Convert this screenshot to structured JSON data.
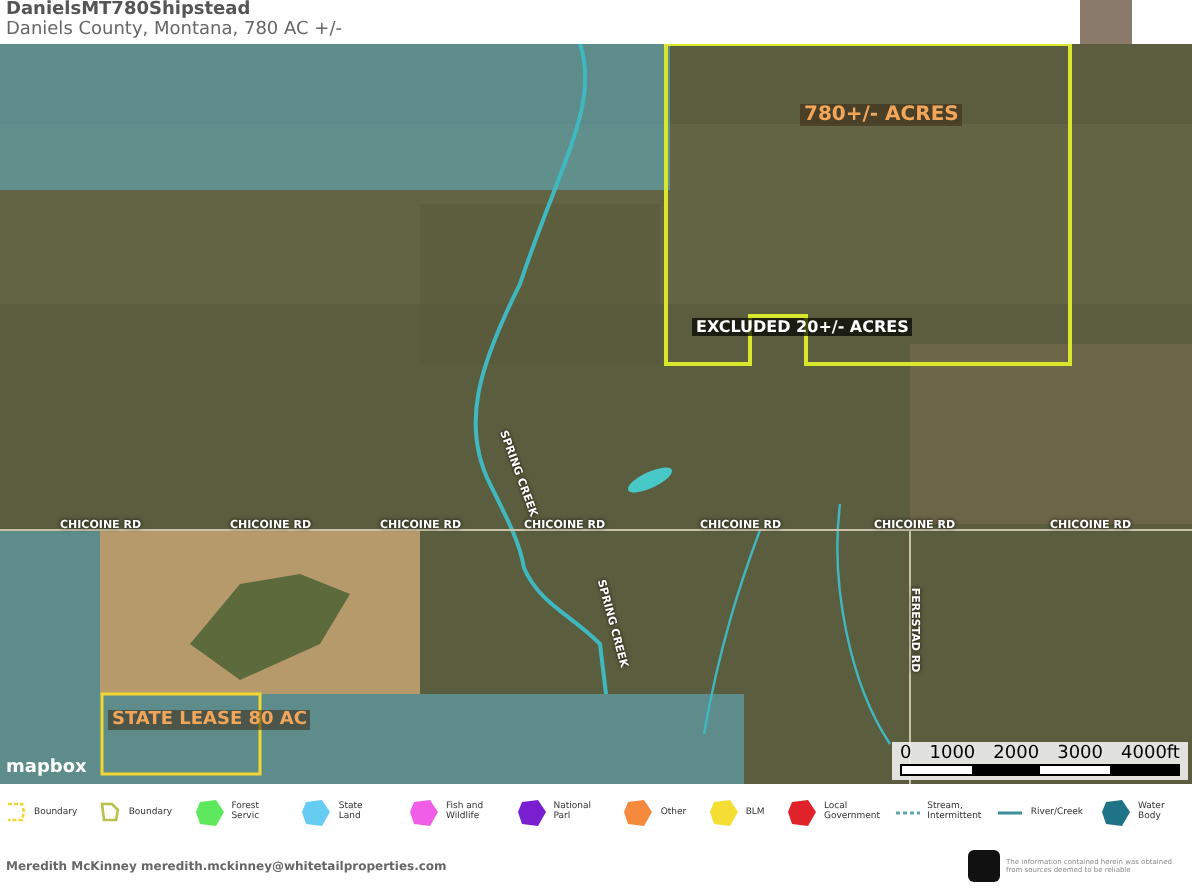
{
  "header": {
    "title": "DanielsMT780Shipstead",
    "subtitle": "Daniels County, Montana, 780 AC +/-"
  },
  "map": {
    "labels": [
      {
        "kind": "acreage",
        "text": "780+/- ACRES"
      },
      {
        "kind": "parcel",
        "text": "EXCLUDED 20+/- ACRES"
      },
      {
        "kind": "acreage",
        "text": "STATE LEASE 80 AC"
      }
    ],
    "roads": [
      "CHICOINE RD",
      "CHICOINE RD",
      "CHICOINE RD",
      "CHICOINE RD",
      "CHICOINE RD",
      "CHICOINE RD",
      "CHICOINE RD",
      "FERESTAD RD"
    ],
    "creeks": [
      "SPRING CREEK",
      "SPRING CREEK"
    ],
    "attribution": "mapbox",
    "scale": [
      "0",
      "1000",
      "2000",
      "3000",
      "4000ft"
    ]
  },
  "legend": [
    {
      "kind": "boundary-dashed",
      "label": "Boundary",
      "color": "#f2d633"
    },
    {
      "kind": "boundary",
      "label": "Boundary",
      "color": "#b8c24a"
    },
    {
      "kind": "area",
      "label": "Forest Servic",
      "color": "#5ee85e"
    },
    {
      "kind": "area",
      "label": "State Land",
      "color": "#66ccf2"
    },
    {
      "kind": "area",
      "label": "Fish and Wildlife",
      "color": "#f05ee8"
    },
    {
      "kind": "area",
      "label": "National Parl",
      "color": "#7a1fd0"
    },
    {
      "kind": "area",
      "label": "Other",
      "color": "#f58a3c"
    },
    {
      "kind": "area",
      "label": "BLM",
      "color": "#f5de33"
    },
    {
      "kind": "area",
      "label": "Local Government",
      "color": "#e0232b"
    },
    {
      "kind": "line-dashed",
      "label": "Stream, Intermittent",
      "color": "#5aa9b0"
    },
    {
      "kind": "line",
      "label": "River/Creek",
      "color": "#3c8f9a"
    },
    {
      "kind": "area",
      "label": "Water Body",
      "color": "#1f7387"
    }
  ],
  "footer": {
    "agent": "Meredith McKinney meredith.mckinney@whitetailproperties.com",
    "disclaimer": "The information contained herein was obtained from sources deemed to be reliable"
  }
}
